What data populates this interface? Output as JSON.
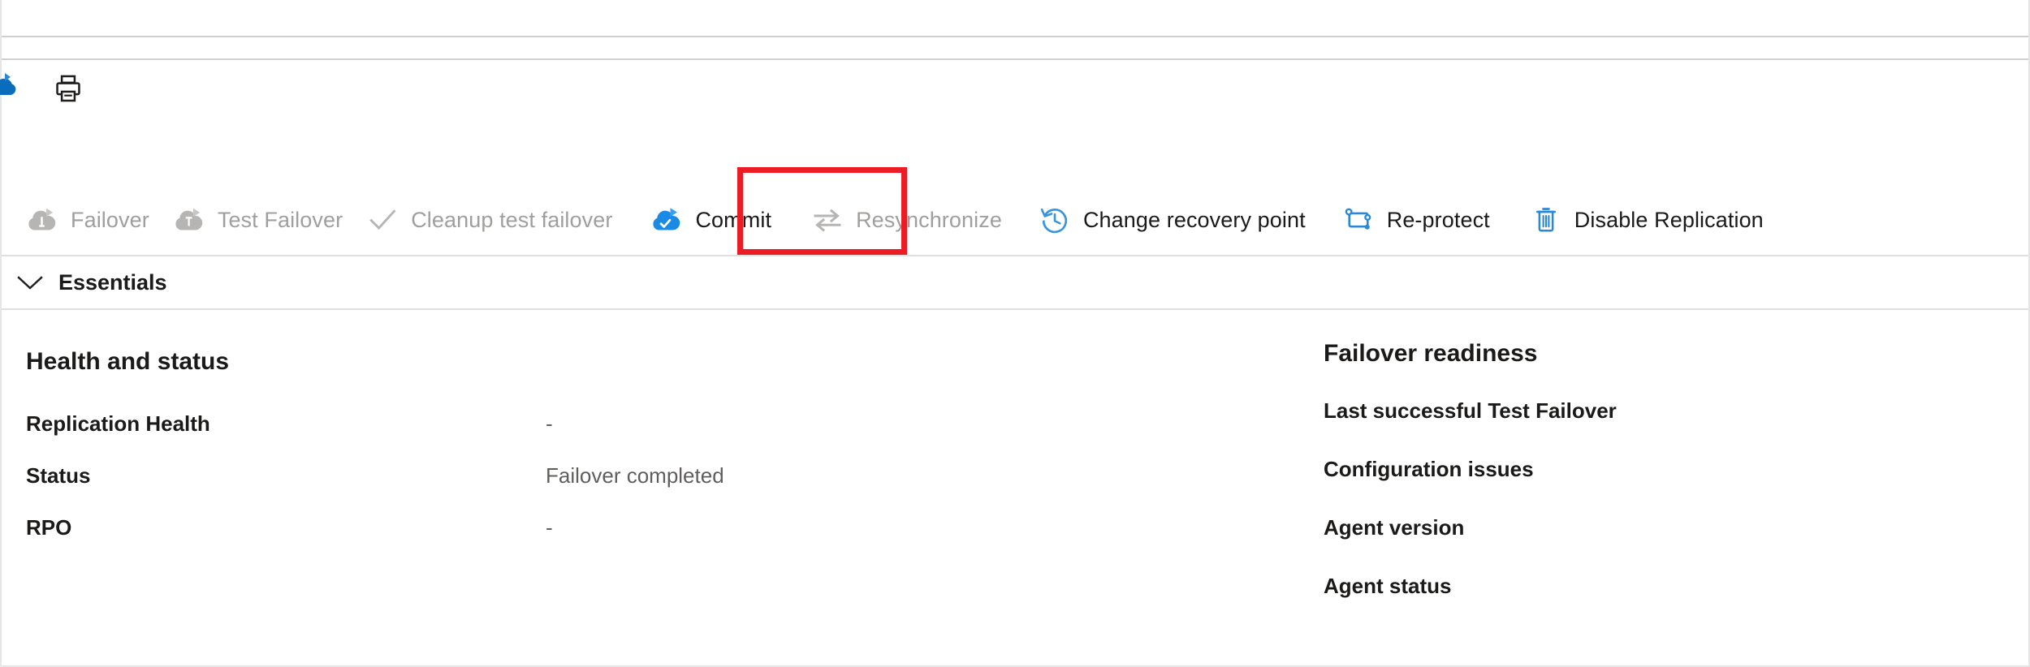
{
  "theme": {
    "accent_blue": "#0078d4",
    "disabled_gray": "#a19f9d",
    "text_primary": "#1b1a19",
    "text_secondary": "#605e5c",
    "highlight_red": "#ec1c24",
    "divider": "#d2d0ce"
  },
  "command_strip": {
    "print_button_name": "Print",
    "print_icon": "printer-icon",
    "clipped_icon": "partial-cloud-icon"
  },
  "toolbar": {
    "items": [
      {
        "label": "Failover",
        "icon": "failover-cloud-icon",
        "enabled": false,
        "highlighted": false
      },
      {
        "label": "Test Failover",
        "icon": "test-failover-cloud-icon",
        "enabled": false,
        "highlighted": false
      },
      {
        "label": "Cleanup test failover",
        "icon": "checkmark-icon",
        "enabled": false,
        "highlighted": false
      },
      {
        "label": "Commit",
        "icon": "commit-cloud-check-icon",
        "enabled": true,
        "highlighted": true
      },
      {
        "label": "Resynchronize",
        "icon": "sync-arrows-icon",
        "enabled": false,
        "highlighted": false
      },
      {
        "label": "Change recovery point",
        "icon": "clock-history-icon",
        "enabled": true,
        "highlighted": false
      },
      {
        "label": "Re-protect",
        "icon": "re-protect-icon",
        "enabled": true,
        "highlighted": false
      },
      {
        "label": "Disable Replication",
        "icon": "trash-bin-icon",
        "enabled": true,
        "highlighted": false
      }
    ]
  },
  "essentials": {
    "label": "Essentials",
    "expanded": true,
    "chevron_icon": "chevron-down-icon"
  },
  "left_pane": {
    "title": "Health and status",
    "rows": [
      {
        "key": "Replication Health",
        "value": "-"
      },
      {
        "key": "Status",
        "value": "Failover completed"
      },
      {
        "key": "RPO",
        "value": "-"
      }
    ]
  },
  "right_pane": {
    "title": "Failover readiness",
    "rows": [
      {
        "key": "Last successful Test Failover",
        "value": ""
      },
      {
        "key": "Configuration issues",
        "value": ""
      },
      {
        "key": "Agent version",
        "value": ""
      },
      {
        "key": "Agent status",
        "value": ""
      }
    ]
  }
}
